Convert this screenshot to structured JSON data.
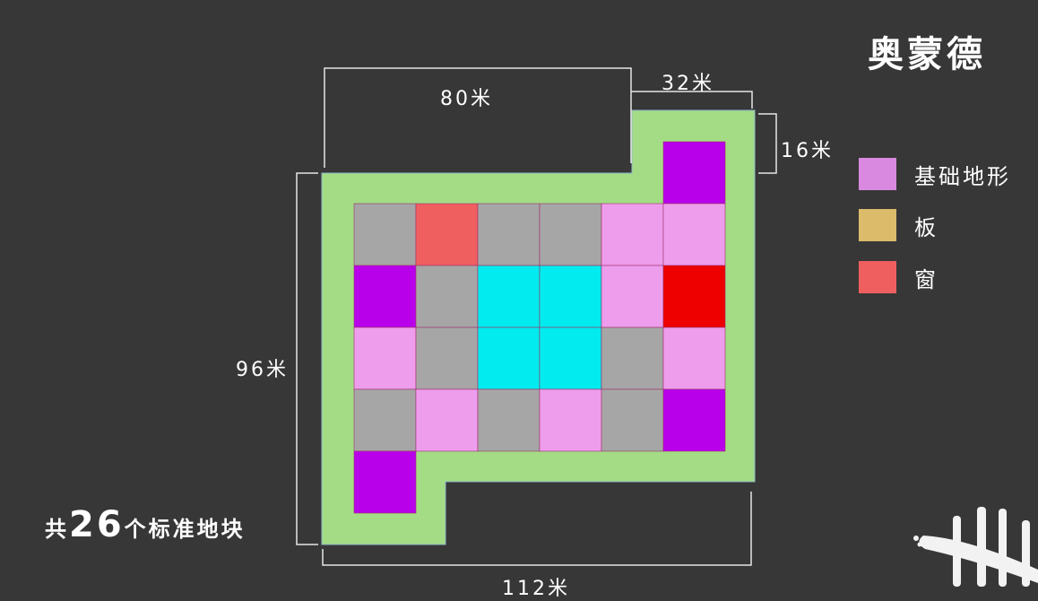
{
  "title": "奥蒙德",
  "dimensions": {
    "top_left": "80米",
    "top_right": "32米",
    "right": "16米",
    "left": "96米",
    "bottom": "112米"
  },
  "legend": [
    {
      "label": "基础地形",
      "color": "#d98ae0"
    },
    {
      "label": "板",
      "color": "#dcbb6a"
    },
    {
      "label": "窗",
      "color": "#ef5f5f"
    }
  ],
  "summary": {
    "prefix": "共",
    "count": "26",
    "suffix": "个标准地块"
  },
  "colors": {
    "background": "#373737",
    "border": "#a4dc86",
    "gray": "#a6a6a6",
    "red": "#ef5f5f",
    "pink": "#ee9ded",
    "purple": "#b800eb",
    "cyan": "#02ebee",
    "brightred": "#ee0000"
  },
  "tiles": [
    [
      null,
      null,
      null,
      null,
      null,
      "purple"
    ],
    [
      "gray",
      "red",
      "gray",
      "gray",
      "pink",
      "pink"
    ],
    [
      "purple",
      "gray",
      "cyan",
      "cyan",
      "pink",
      "brightred"
    ],
    [
      "pink",
      "gray",
      "cyan",
      "cyan",
      "gray",
      "pink"
    ],
    [
      "gray",
      "pink",
      "gray",
      "pink",
      "gray",
      "purple"
    ],
    [
      "purple",
      null,
      null,
      null,
      null,
      null
    ]
  ]
}
